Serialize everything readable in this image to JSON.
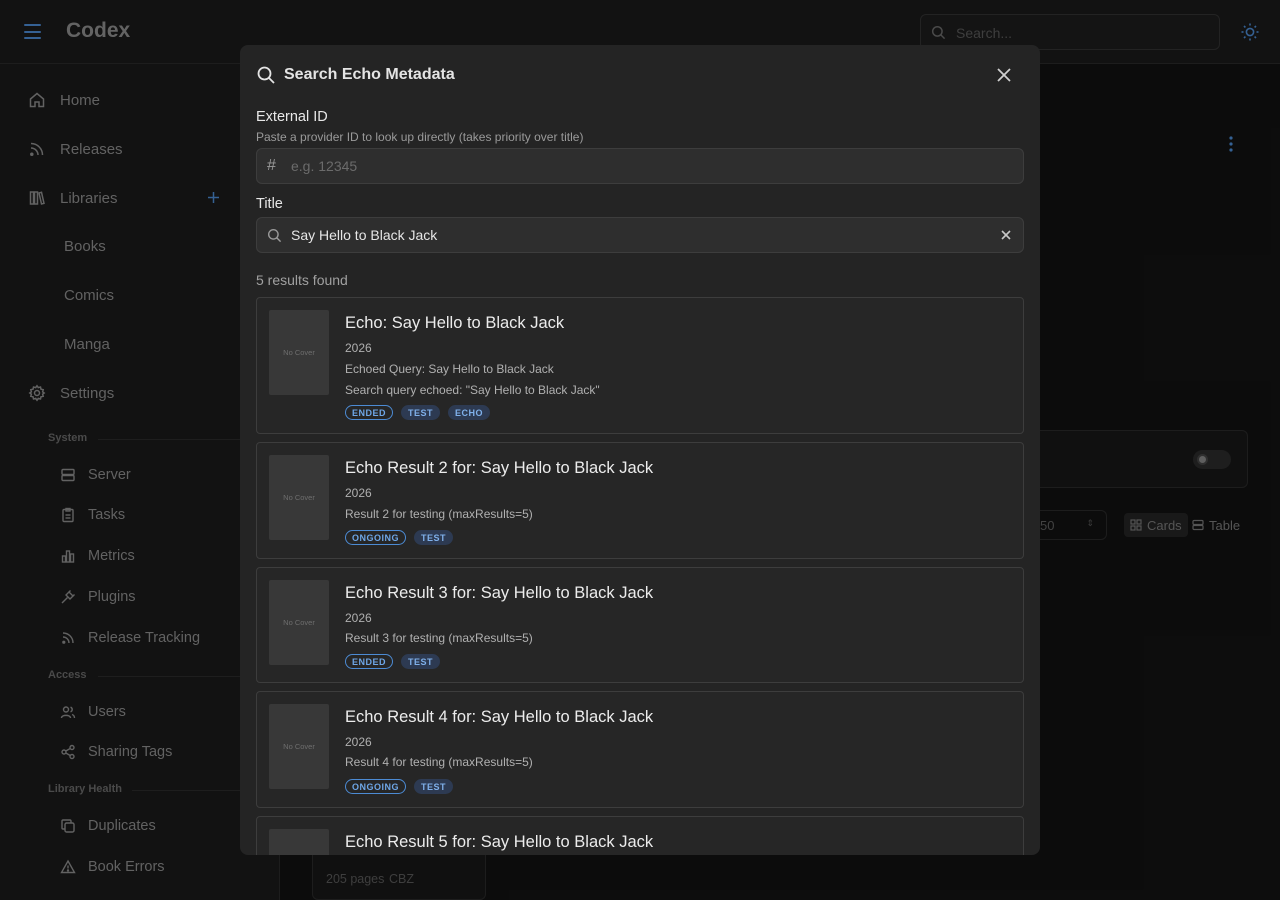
{
  "app": {
    "title": "Codex"
  },
  "header": {
    "search_placeholder": "Search..."
  },
  "sidebar": {
    "nav": [
      {
        "label": "Home",
        "icon": "home-icon"
      },
      {
        "label": "Releases",
        "icon": "rss-icon"
      },
      {
        "label": "Libraries",
        "icon": "libraries-icon"
      }
    ],
    "libraries": [
      "Books",
      "Comics",
      "Manga"
    ],
    "settings_label": "Settings",
    "sections": {
      "system": "System",
      "access": "Access",
      "health": "Library Health"
    },
    "system_items": [
      "Server",
      "Tasks",
      "Metrics",
      "Plugins",
      "Release Tracking"
    ],
    "access_items": [
      "Users",
      "Sharing Tags"
    ],
    "health_items": [
      "Duplicates",
      "Book Errors"
    ]
  },
  "background": {
    "page_size_value": "50",
    "view_cards": "Cards",
    "view_table": "Table",
    "book_pages": "205 pages",
    "book_format": "CBZ"
  },
  "modal": {
    "title": "Search Echo Metadata",
    "external_id": {
      "label": "External ID",
      "description": "Paste a provider ID to look up directly (takes priority over title)",
      "placeholder": "e.g. 12345"
    },
    "title_field": {
      "label": "Title",
      "value": "Say Hello to Black Jack"
    },
    "result_count": "5 results found",
    "no_cover": "No Cover",
    "results": [
      {
        "title": "Echo: Say Hello to Black Jack",
        "year": "2026",
        "lines": [
          "Echoed Query: Say Hello to Black Jack",
          "Search query echoed: \"Say Hello to Black Jack\""
        ],
        "tags": [
          {
            "text": "ENDED",
            "style": "outline"
          },
          {
            "text": "TEST",
            "style": "filled"
          },
          {
            "text": "ECHO",
            "style": "filled"
          }
        ]
      },
      {
        "title": "Echo Result 2 for: Say Hello to Black Jack",
        "year": "2026",
        "lines": [
          "Result 2 for testing (maxResults=5)"
        ],
        "tags": [
          {
            "text": "ONGOING",
            "style": "outline"
          },
          {
            "text": "TEST",
            "style": "filled"
          }
        ]
      },
      {
        "title": "Echo Result 3 for: Say Hello to Black Jack",
        "year": "2026",
        "lines": [
          "Result 3 for testing (maxResults=5)"
        ],
        "tags": [
          {
            "text": "ENDED",
            "style": "outline"
          },
          {
            "text": "TEST",
            "style": "filled"
          }
        ]
      },
      {
        "title": "Echo Result 4 for: Say Hello to Black Jack",
        "year": "2026",
        "lines": [
          "Result 4 for testing (maxResults=5)"
        ],
        "tags": [
          {
            "text": "ONGOING",
            "style": "outline"
          },
          {
            "text": "TEST",
            "style": "filled"
          }
        ]
      },
      {
        "title": "Echo Result 5 for: Say Hello to Black Jack",
        "year": "",
        "lines": [],
        "tags": []
      }
    ]
  },
  "colors": {
    "accent": "#4c8bd4",
    "modal_bg": "#242424",
    "page_bg": "#121212"
  }
}
